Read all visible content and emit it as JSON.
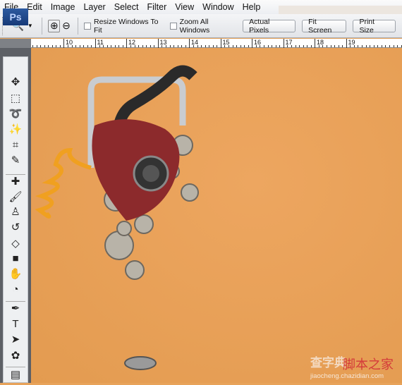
{
  "menu": [
    "File",
    "Edit",
    "Image",
    "Layer",
    "Select",
    "Filter",
    "View",
    "Window",
    "Help"
  ],
  "options": {
    "resize_windows": {
      "label": "Resize Windows To Fit",
      "checked": false
    },
    "zoom_all": {
      "label": "Zoom All Windows",
      "checked": false
    },
    "buttons": [
      "Actual Pixels",
      "Fit Screen",
      "Print Size"
    ]
  },
  "ruler": {
    "labels": [
      "10",
      "11",
      "12",
      "13",
      "14",
      "15",
      "16",
      "17",
      "18",
      "19"
    ]
  },
  "toolbox": {
    "logo": "Ps"
  },
  "watermark": {
    "line1": "查字典",
    "line2": "脚本之家",
    "line3": "jiaocheng.chazidian.com"
  },
  "colors": {
    "canvas": "#e8a35a",
    "ps_blue": "#1f4a8e"
  }
}
